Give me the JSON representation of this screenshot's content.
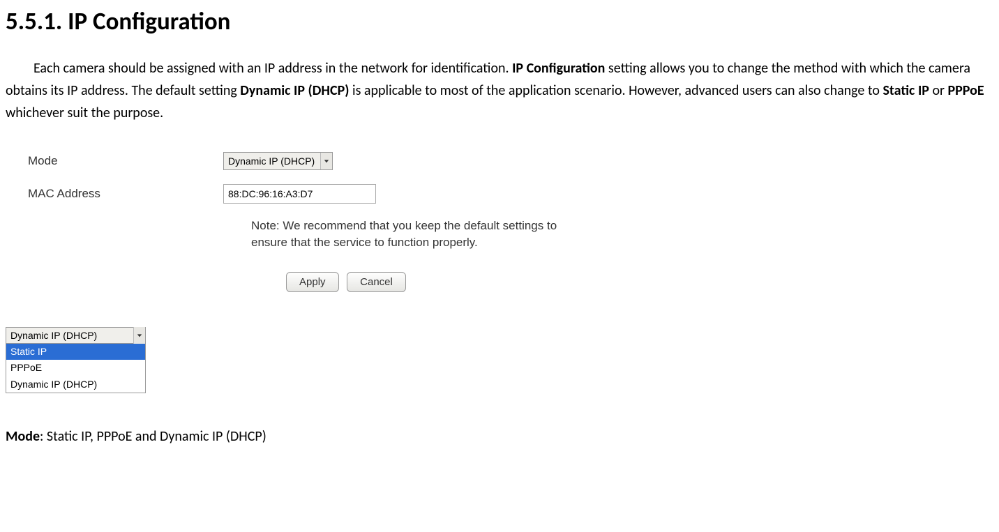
{
  "heading": "5.5.1.   IP Configuration",
  "paragraph": {
    "prefix": "Each camera should be assigned with an IP address in the network for identification. ",
    "bold1": "IP Configuration",
    "mid1": " setting allows you to change the method with which the camera obtains its IP address. The default setting ",
    "bold2": "Dynamic IP (DHCP)",
    "mid2": " is applicable to most of the application scenario. However, advanced users can also change to ",
    "bold3": "Static IP",
    "mid3": " or ",
    "bold4": "PPPoE",
    "suffix": " whichever suit the purpose."
  },
  "form": {
    "mode_label": "Mode",
    "mode_value": "Dynamic IP (DHCP)",
    "mac_label": "MAC Address",
    "mac_value": "88:DC:96:16:A3:D7",
    "note": "Note: We recommend that you keep the default settings to ensure that the service to function properly.",
    "apply": "Apply",
    "cancel": "Cancel"
  },
  "dropdown": {
    "header": "Dynamic IP (DHCP)",
    "options": [
      "Static IP",
      "PPPoE",
      "Dynamic IP (DHCP)"
    ],
    "highlighted_index": 0
  },
  "footer": {
    "label": "Mode",
    "text": ": Static IP, PPPoE and Dynamic IP (DHCP)"
  }
}
